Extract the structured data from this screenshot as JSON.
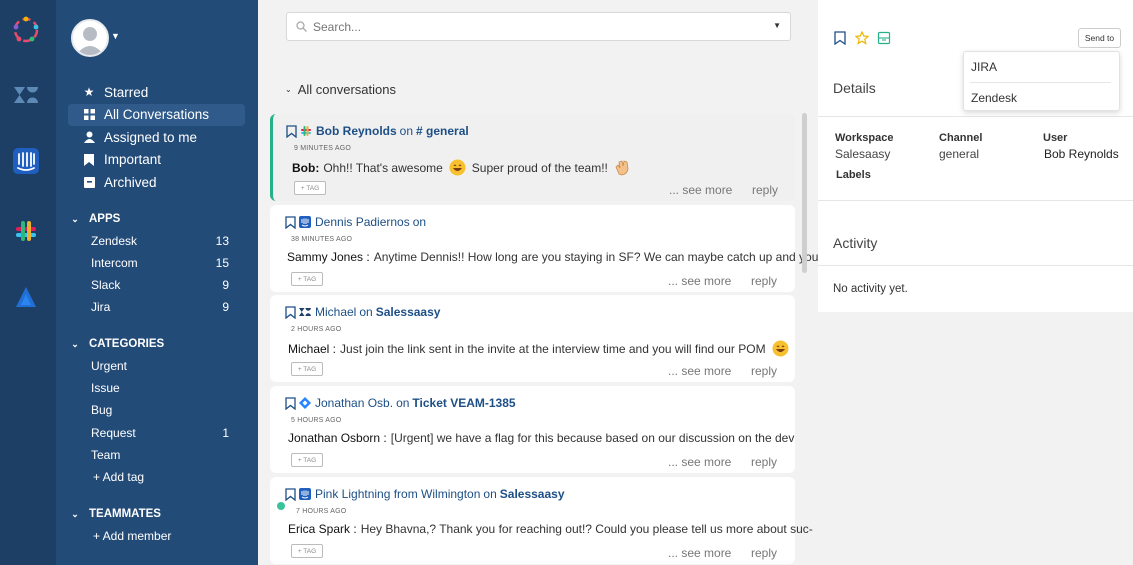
{
  "rail": {
    "apps": [
      {
        "name": "app-logo-icon"
      },
      {
        "name": "zendesk-icon"
      },
      {
        "name": "intercom-icon"
      },
      {
        "name": "slack-icon"
      },
      {
        "name": "jira-icon"
      }
    ]
  },
  "nav": {
    "main": [
      {
        "label": "Starred",
        "icon": "star-icon"
      },
      {
        "label": "All Conversations",
        "icon": "grid-icon"
      },
      {
        "label": "Assigned to me",
        "icon": "user-icon"
      },
      {
        "label": "Important",
        "icon": "bookmark-icon"
      },
      {
        "label": "Archived",
        "icon": "archive-icon"
      }
    ],
    "apps_title": "APPS",
    "apps": [
      {
        "label": "Zendesk",
        "count": "13"
      },
      {
        "label": "Intercom",
        "count": "15"
      },
      {
        "label": "Slack",
        "count": "9"
      },
      {
        "label": "Jira",
        "count": "9"
      }
    ],
    "categories_title": "CATEGORIES",
    "categories": [
      {
        "label": "Urgent",
        "count": ""
      },
      {
        "label": "Issue",
        "count": ""
      },
      {
        "label": "Bug",
        "count": ""
      },
      {
        "label": "Request",
        "count": "1"
      },
      {
        "label": "Team",
        "count": ""
      }
    ],
    "add_tag": "+ Add tag",
    "teammates_title": "TEAMMATES",
    "add_member": "+ Add member"
  },
  "search": {
    "placeholder": "Search..."
  },
  "list": {
    "heading": "All conversations",
    "tag_label": "+ TAG",
    "see_more": "... see more",
    "reply": "reply",
    "cards": [
      {
        "app": "slack",
        "name": "Bob Reynolds",
        "on": "on",
        "target": "# general",
        "time": "9 MINUTES AGO",
        "author": "Bob:",
        "message": "Ohh!! That's awesome",
        "message2": "Super proud of the team!!"
      },
      {
        "app": "intercom",
        "name": "Dennis Padiernos",
        "on": "on",
        "target": "",
        "time": "38 MINUTES AGO",
        "author": "Sammy Jones :",
        "message": "Anytime Dennis!! How long are you staying in SF? We can maybe catch up and you",
        "message2": ""
      },
      {
        "app": "zendesk",
        "name": "Michael",
        "on": "on",
        "target": "Salessaasy",
        "time": "2 HOURS AGO",
        "author": "Michael :",
        "message": "Just join the link sent in the invite at the interview time and you will find our POM",
        "message2": ""
      },
      {
        "app": "jira",
        "name": "Jonathan Osb.",
        "on": "on",
        "target": "Ticket VEAM-1385",
        "time": "5 HOURS AGO",
        "author": "Jonathan Osborn :",
        "message": "[Urgent] we have a flag for this because based on our discussion on the dev",
        "message2": ""
      },
      {
        "app": "intercom",
        "name": "Pink Lightning from Wilmington",
        "on": "on",
        "target": "Salessaasy",
        "time": "7 HOURS AGO",
        "author": "Erica Spark :",
        "message": "Hey Bhavna,? Thank you for reaching out!? Could you please tell us more about suc-",
        "message2": ""
      }
    ]
  },
  "panel": {
    "send_to": "Send to",
    "dropdown": [
      "JIRA",
      "Zendesk"
    ],
    "details_title": "Details",
    "workspace_label": "Workspace",
    "workspace_value": "Salesaasy",
    "channel_label": "Channel",
    "channel_value": "general",
    "user_label": "User",
    "user_value": "Bob Reynolds",
    "labels_label": "Labels",
    "activity_title": "Activity",
    "no_activity": "No activity yet."
  },
  "colors": {
    "rail": "#1d3f66",
    "nav": "#234b78",
    "accent": "#26b08a",
    "link": "#1d4f86"
  }
}
